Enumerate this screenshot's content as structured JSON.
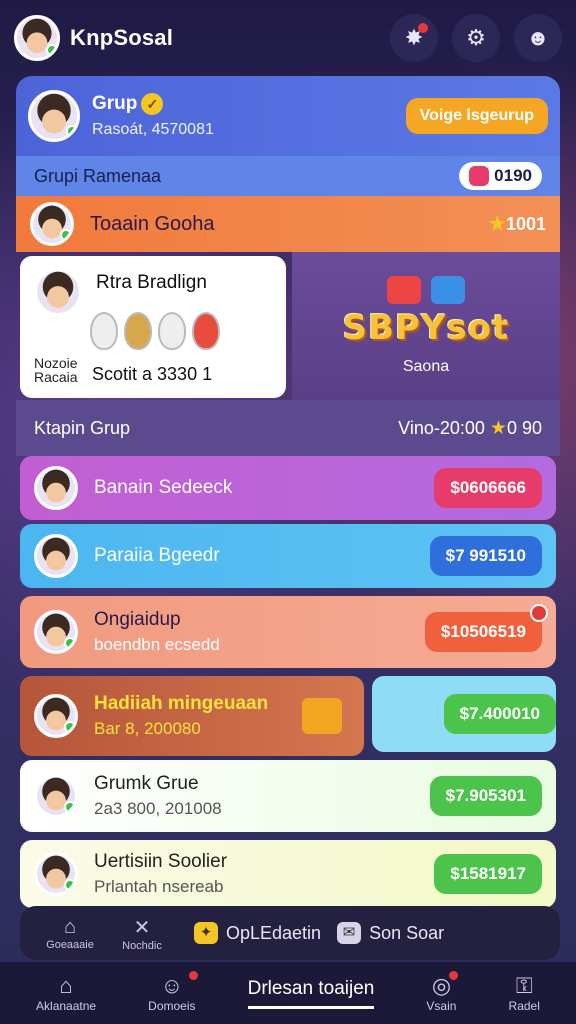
{
  "app": {
    "title": "KnpSosal"
  },
  "top_icons": [
    "puzzle-icon",
    "gear-icon",
    "chat-icon"
  ],
  "header": {
    "name": "Grup",
    "subtitle": "Rasoát, 4570081",
    "button": "Voige lsgeurup"
  },
  "section": {
    "title": "Grupi Ramenaa",
    "pill_value": "0190"
  },
  "top_row": {
    "name": "Toaain Gooha",
    "value": "1001"
  },
  "white_card": {
    "title": "Rtra Bradlign",
    "meta_line1": "Nozoie",
    "meta_line2": "Racaia",
    "value": "Scotit a 3330  1"
  },
  "promo_card": {
    "logo": "SBPYsot",
    "caption": "Saona"
  },
  "list_header": {
    "title": "Ktapin Grup",
    "value": "Vino-20:00",
    "value2": "0 90"
  },
  "items": [
    {
      "name": "Banain Sedeeck",
      "sub": "",
      "price": "$0606666"
    },
    {
      "name": "Paraiia Bgeedr",
      "sub": "",
      "price": "$7 991510"
    },
    {
      "name": "Ongiaidup",
      "sub": "boendbn ecsedd",
      "price": "$10506519"
    },
    {
      "name": "Hadiiah mingeuaan",
      "sub": "Bar 8, 200080",
      "price": "$7.400010"
    },
    {
      "name": "Grumk Grue",
      "sub": "2a3 800, 201008",
      "price": "$7.905301"
    },
    {
      "name": "Uertisiin Soolier",
      "sub": "Prlantah nsereab",
      "price": "$1581917"
    }
  ],
  "colors": {
    "accent": "#5b79e6",
    "orange": "#f5a623",
    "pink": "#e63c6c",
    "blue": "#2f6fdc",
    "green": "#4cc34a",
    "red": "#e74a3c"
  },
  "subnav": [
    {
      "label": "Goeaaaie",
      "icon": "home-icon"
    },
    {
      "label": "Nochdic",
      "icon": "tools-icon"
    },
    {
      "label": "OpLEdaetin",
      "icon": "star-icon"
    },
    {
      "label": "Son Soar",
      "icon": "mail-icon"
    }
  ],
  "bottom_nav": [
    {
      "label": "Aklanaatne",
      "icon": "home-icon"
    },
    {
      "label": "Domoeis",
      "icon": "user-icon"
    },
    {
      "label": "Drlesan toaijen",
      "icon": ""
    },
    {
      "label": "Vsain",
      "icon": "ring-icon"
    },
    {
      "label": "Radel",
      "icon": "lock-icon"
    }
  ]
}
